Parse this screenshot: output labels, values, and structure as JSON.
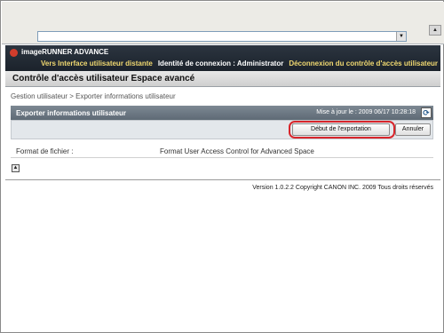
{
  "address": {
    "value": ""
  },
  "brand": {
    "title": "imageRUNNER ADVANCE"
  },
  "nav": {
    "remote_ui_link": "Vers Interface utilisateur distante",
    "login_identity": "Identité de connexion : Administrator",
    "logout_link": "Déconnexion du contrôle d'accès utilisateur"
  },
  "app": {
    "title": "Contrôle d'accès utilisateur Espace avancé"
  },
  "breadcrumb": "Gestion utilisateur > Exporter informations utilisateur",
  "panel": {
    "title": "Exporter informations utilisateur",
    "updated": "Mise à jour le : 2009 06/17 10:28:18",
    "export_button": "Début de l'exportation",
    "cancel_button": "Annuler"
  },
  "fields": [
    {
      "label": "Format de fichier :",
      "value": "Format User Access Control for Advanced Space"
    }
  ],
  "footer": {
    "version": "Version 1.0.2.2 Copyright CANON INC. 2009 Tous droits réservés"
  },
  "icons": {
    "brand_logo": "canon-logo-icon",
    "refresh": "refresh-icon",
    "top": "page-top-icon",
    "dropdown": "chevron-down-icon"
  },
  "colors": {
    "brand_bar": "#1f2730",
    "nav_link": "#f0d870",
    "panel_header": "#6b7783",
    "highlight": "#d8252b"
  }
}
